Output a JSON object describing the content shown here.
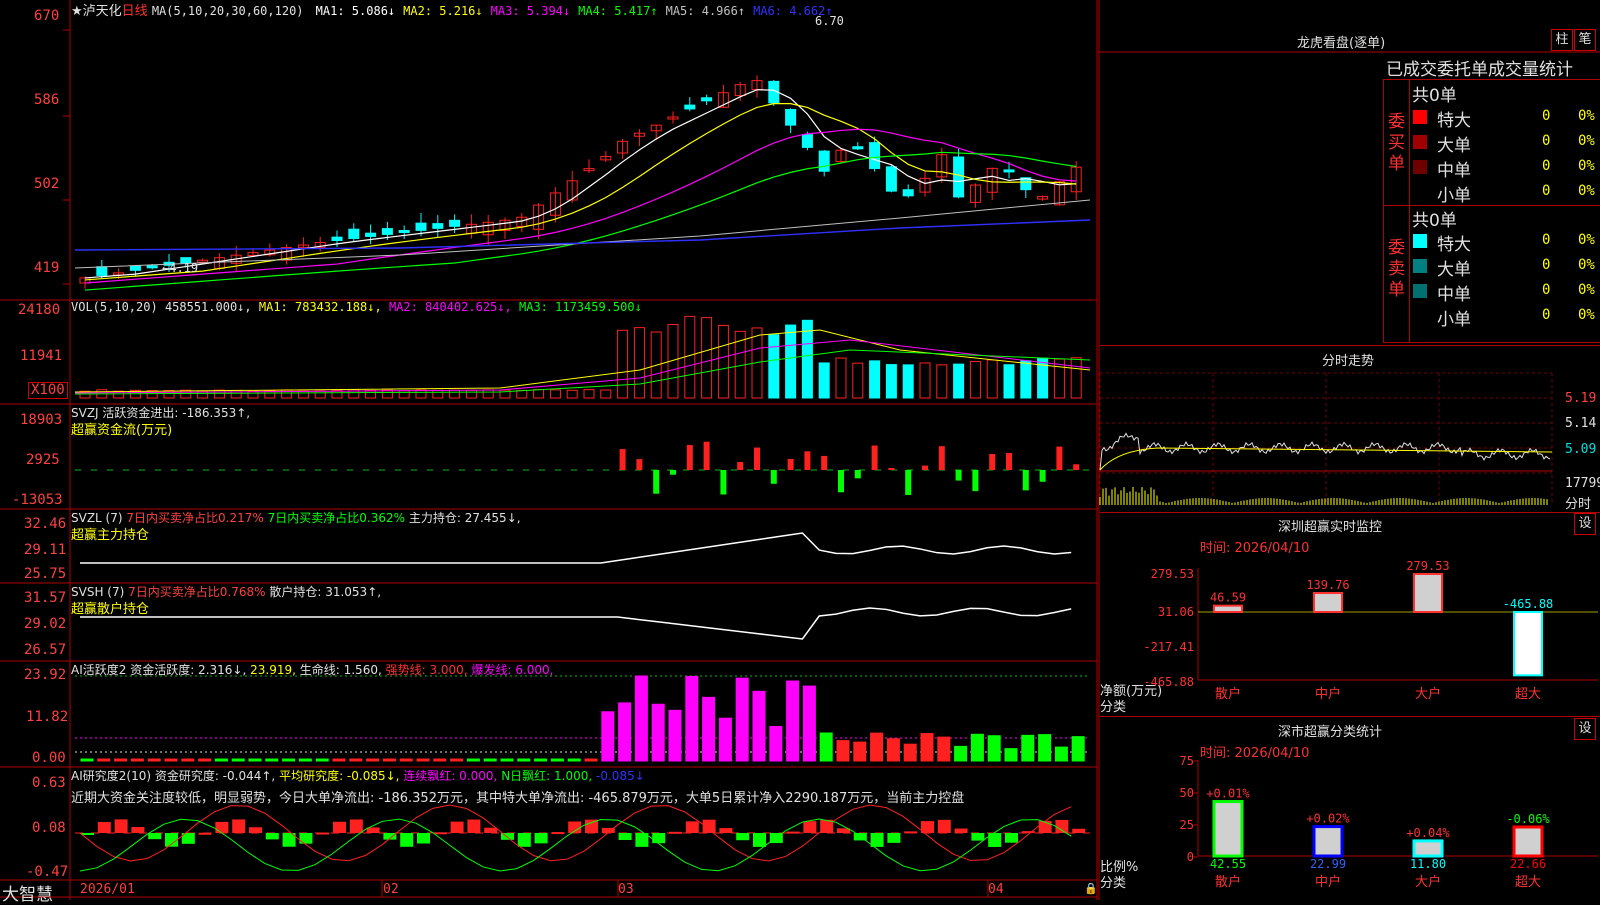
{
  "brand": "大智慧",
  "kline_header": {
    "title": "★泸天化",
    "period": "日线",
    "ma_params": "MA(5,10,20,30,60,120)",
    "ma": [
      {
        "label": "MA1: 5.086↓",
        "color": "#ffffff"
      },
      {
        "label": "MA2: 5.216↓",
        "color": "#ffff00"
      },
      {
        "label": "MA3: 5.394↓",
        "color": "#ff00ff"
      },
      {
        "label": "MA4: 5.417↑",
        "color": "#00ff00"
      },
      {
        "label": "MA5: 4.966↑",
        "color": "#c0c0c0"
      },
      {
        "label": "MA6: 4.662↑",
        "color": "#3030ff"
      }
    ],
    "high_mark": "6.70",
    "low_mark": "4.19"
  },
  "axes": {
    "price": [
      "670",
      "586",
      "502",
      "419"
    ],
    "vol": [
      "24180",
      "11941",
      "X100"
    ],
    "svzj": [
      "18903",
      "2925",
      "-13053"
    ],
    "svzl": [
      "32.46",
      "29.11",
      "25.75"
    ],
    "svsh": [
      "31.57",
      "29.02",
      "26.57"
    ],
    "ai_active": [
      "23.92",
      "11.82",
      "0.00"
    ],
    "ai_research": [
      "0.63",
      "0.08",
      "-0.47"
    ],
    "dates": [
      "2026/01",
      "02",
      "03",
      "04"
    ]
  },
  "panels": {
    "vol": {
      "t1": "VOL(5,10,20)",
      "t2": "458551.000↓,",
      "t3": "MA1: 783432.188↓,",
      "t4": "MA2: 840402.625↓,",
      "t5": "MA3: 1173459.500↓"
    },
    "svzj": {
      "t1": "SVZJ  活跃资金进出: -186.353↑,",
      "t2": "超赢资金流(万元)"
    },
    "svzl": {
      "t1": "SVZL (7)",
      "t2": "7日内买卖净占比0.217%",
      "t3": "7日内买卖净占比0.362%",
      "t4": "主力持仓: 27.455↓,",
      "t5": "超赢主力持仓"
    },
    "svsh": {
      "t1": "SVSH (7)",
      "t2": "7日内买卖净占比0.768%",
      "t3": "散户持仓: 31.053↑,",
      "t4": "超赢散户持仓"
    },
    "ai_active": {
      "t1": "AI活跃度2 资金活跃度: 2.316↓,",
      "t2": "23.919,",
      "t3": "生命线: 1.560,",
      "t4": "强势线: 3.000,",
      "t5": "爆发线: 6.000,"
    },
    "ai_research": {
      "t1": "AI研究度2(10) 资金研究度: -0.044↑,",
      "t2": "平均研究度: -0.085↓,",
      "t3": "连续飘红: 0.000,",
      "t4": "N日飘红: 1.000,",
      "t5": "-0.085↓",
      "summary": "近期大资金关注度较低，明显弱势，今日大单净流出: -186.352万元，其中特大单净流出: -465.879万元，大单5日累计净入2290.187万元，当前主力控盘"
    }
  },
  "longhu": {
    "title": "龙虎看盘(逐单)",
    "btn1": "柱",
    "btn2": "笔",
    "tabs": "已成交委托单成交量统计",
    "buy_group": "委买单",
    "sell_group": "委卖单",
    "buy_total": "共0单",
    "sell_total": "共0单",
    "buy_rows": [
      {
        "name": "特大",
        "count": "0",
        "pct": "0%",
        "color": "#ff0000"
      },
      {
        "name": "大单",
        "count": "0",
        "pct": "0%",
        "color": "#a00000"
      },
      {
        "name": "中单",
        "count": "0",
        "pct": "0%",
        "color": "#700000"
      },
      {
        "name": "小单",
        "count": "0",
        "pct": "0%",
        "color": ""
      }
    ],
    "sell_rows": [
      {
        "name": "特大",
        "count": "0",
        "pct": "0%",
        "color": "#00ffff"
      },
      {
        "name": "大单",
        "count": "0",
        "pct": "0%",
        "color": "#008080"
      },
      {
        "name": "中单",
        "count": "0",
        "pct": "0%",
        "color": "#007070"
      },
      {
        "name": "小单",
        "count": "0",
        "pct": "0%",
        "color": ""
      }
    ]
  },
  "minute": {
    "title": "分时走势",
    "prices": [
      "5.19",
      "5.14",
      "5.09"
    ],
    "vol": "17799",
    "vol_label": "分时"
  },
  "sz_monitor": {
    "title": "深圳超赢实时监控",
    "btn": "设",
    "time": "时间: 2026/04/10",
    "yaxis": [
      "279.53",
      "31.06",
      "-217.41",
      "-465.88"
    ],
    "ylabel1": "净额(万元)",
    "ylabel2": "分类",
    "bars": [
      {
        "name": "散户",
        "value": 46.59,
        "label": "46.59"
      },
      {
        "name": "中户",
        "value": 139.76,
        "label": "139.76"
      },
      {
        "name": "大户",
        "value": 279.53,
        "label": "279.53"
      },
      {
        "name": "超大",
        "value": -465.88,
        "label": "-465.88"
      }
    ]
  },
  "sz_class": {
    "title": "深市超赢分类统计",
    "btn": "设",
    "time": "时间: 2026/04/10",
    "yaxis": [
      "75",
      "50",
      "25",
      "0"
    ],
    "ylabel1": "比例%",
    "ylabel2": "分类",
    "bars": [
      {
        "name": "散户",
        "value": 42.55,
        "label": "42.55",
        "change": "+0.01%",
        "color": "#00ff00"
      },
      {
        "name": "中户",
        "value": 22.99,
        "label": "22.99",
        "change": "+0.02%",
        "color": "#0000ff"
      },
      {
        "name": "大户",
        "value": 11.8,
        "label": "11.80",
        "change": "+0.04%",
        "color": "#00ffff"
      },
      {
        "name": "超大",
        "value": 22.66,
        "label": "22.66",
        "change": "-0.06%",
        "color": "#ff0000"
      }
    ]
  }
}
